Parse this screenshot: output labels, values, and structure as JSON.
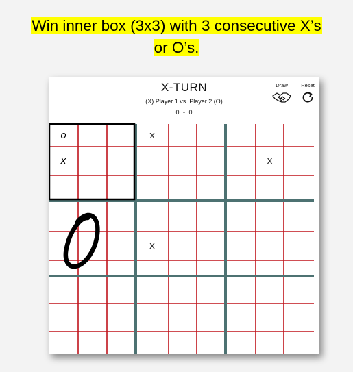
{
  "headline": {
    "line1": "Win inner box (3x3) with 3 consecutive X’s",
    "line2": "or O’s."
  },
  "game": {
    "turn_label": "X-TURN",
    "players_label": "(X) Player 1 vs. Player 2 (O)",
    "score": "0 - 0",
    "draw_label": "Draw",
    "reset_label": "Reset",
    "draw_icon": "handshake-icon",
    "reset_icon": "refresh-icon"
  },
  "marks": [
    {
      "row": 0,
      "col": 0,
      "value": "o"
    },
    {
      "row": 1,
      "col": 0,
      "value": "x"
    },
    {
      "row": 0,
      "col": 3,
      "value": "x"
    },
    {
      "row": 1,
      "col": 7,
      "value": "x"
    },
    {
      "row": 4,
      "col": 3,
      "value": "x"
    }
  ],
  "handwritten_mark": "O",
  "colors": {
    "highlight": "#ffff00",
    "grid_line": "#c0141c",
    "board_divider": "#4d7272",
    "active_box_border": "#000000"
  }
}
